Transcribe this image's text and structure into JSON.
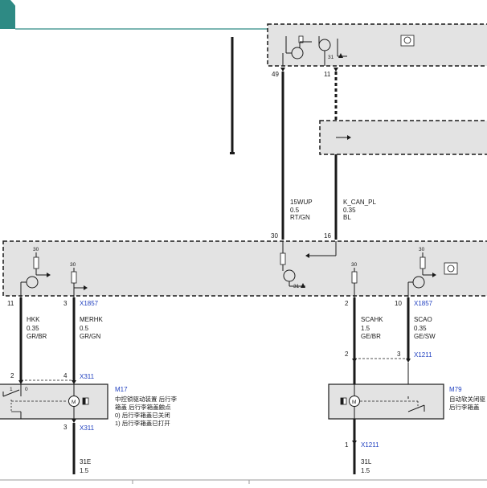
{
  "colors": {
    "box_fill": "#e3e3e3",
    "wire": "#1a1a1a",
    "connector_blue": "#1f3fbf",
    "header_teal": "#2e8a84"
  },
  "pins": {
    "p49": "49",
    "p11_top": "11",
    "p30_left": "30",
    "p16": "16",
    "p11_left": "11",
    "p3_left": "3",
    "p2_right": "2",
    "p10_right": "10",
    "p2_mid": "2",
    "p3_mid": "3",
    "p2_m17": "2",
    "p4_m17": "4",
    "p3_m17b": "3",
    "p1_m79b": "1",
    "p1_m17sw": "1",
    "p0_m17sw": "0"
  },
  "terminals": {
    "t31_top": "31",
    "t30_a": "30",
    "t30_b": "30",
    "t31_mid": "31",
    "t30_c": "30",
    "t30_d": "30"
  },
  "wires": {
    "w15wup": {
      "name": "15WUP",
      "gauge": "0.5",
      "color": "RT/GN"
    },
    "wkcan": {
      "name": "K_CAN_PL",
      "gauge": "0.35",
      "color": "BL"
    },
    "whkk": {
      "name": "HKK",
      "gauge": "0.35",
      "color": "GR/BR"
    },
    "wmerhk": {
      "name": "MERHK",
      "gauge": "0.5",
      "color": "GR/GN"
    },
    "wscahk": {
      "name": "SCAHK",
      "gauge": "1.5",
      "color": "GE/BR"
    },
    "wscao": {
      "name": "SCAO",
      "gauge": "0.35",
      "color": "GE/SW"
    },
    "w31e": {
      "name": "31E",
      "gauge": "1.5"
    },
    "w31l": {
      "name": "31L",
      "gauge": "1.5"
    }
  },
  "connectors": {
    "x1857_left": "X1857",
    "x1857_right": "X1857",
    "x1211_top": "X1211",
    "x311_top": "X311",
    "x311_bottom": "X311",
    "x1211_bottom": "X1211"
  },
  "components": {
    "m17": {
      "id": "M17",
      "desc1": "中控锁驱动装置 后行李",
      "desc2": "箱盖 后行李箱盖触点",
      "desc3": "0) 后行李箱盖已关闭",
      "desc4": "1) 后行李箱盖已打开"
    },
    "m79": {
      "id": "M79",
      "desc1": "自动软关闭驱",
      "desc2": "后行李箱盖"
    },
    "motor_symbol": "M"
  }
}
